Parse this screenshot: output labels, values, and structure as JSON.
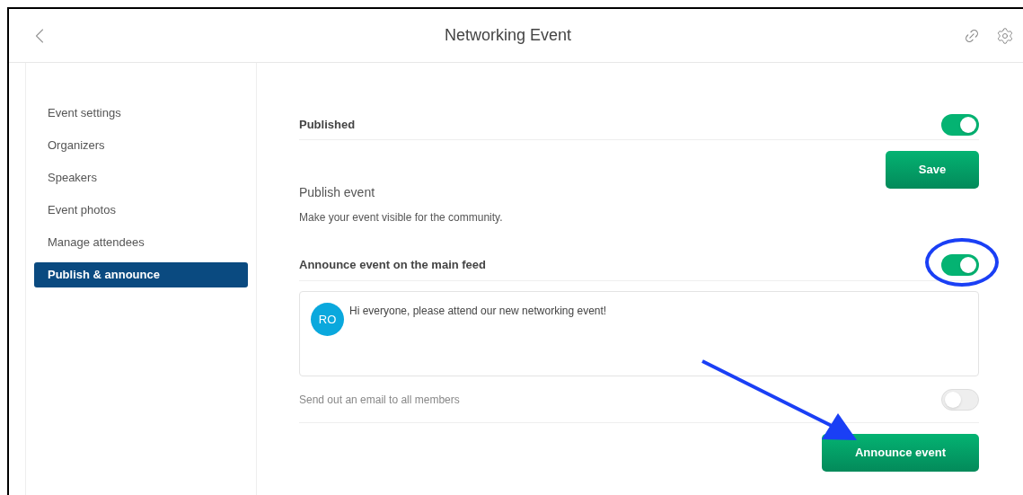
{
  "header": {
    "title": "Networking Event"
  },
  "sidebar": {
    "items": [
      {
        "label": "Event settings",
        "selected": false
      },
      {
        "label": "Organizers",
        "selected": false
      },
      {
        "label": "Speakers",
        "selected": false
      },
      {
        "label": "Event photos",
        "selected": false
      },
      {
        "label": "Manage attendees",
        "selected": false
      },
      {
        "label": "Publish & announce",
        "selected": true
      }
    ]
  },
  "published": {
    "label": "Published",
    "on": true
  },
  "save_button": "Save",
  "publish_section": {
    "title": "Publish event",
    "description": "Make your event visible for the community."
  },
  "announce": {
    "label": "Announce event on the main feed",
    "on": true,
    "highlighted": true
  },
  "post": {
    "avatar": "RO",
    "message": "Hi everyone, please attend our new networking event!"
  },
  "email": {
    "label": "Send out an email to all members",
    "on": false
  },
  "announce_button": "Announce event"
}
